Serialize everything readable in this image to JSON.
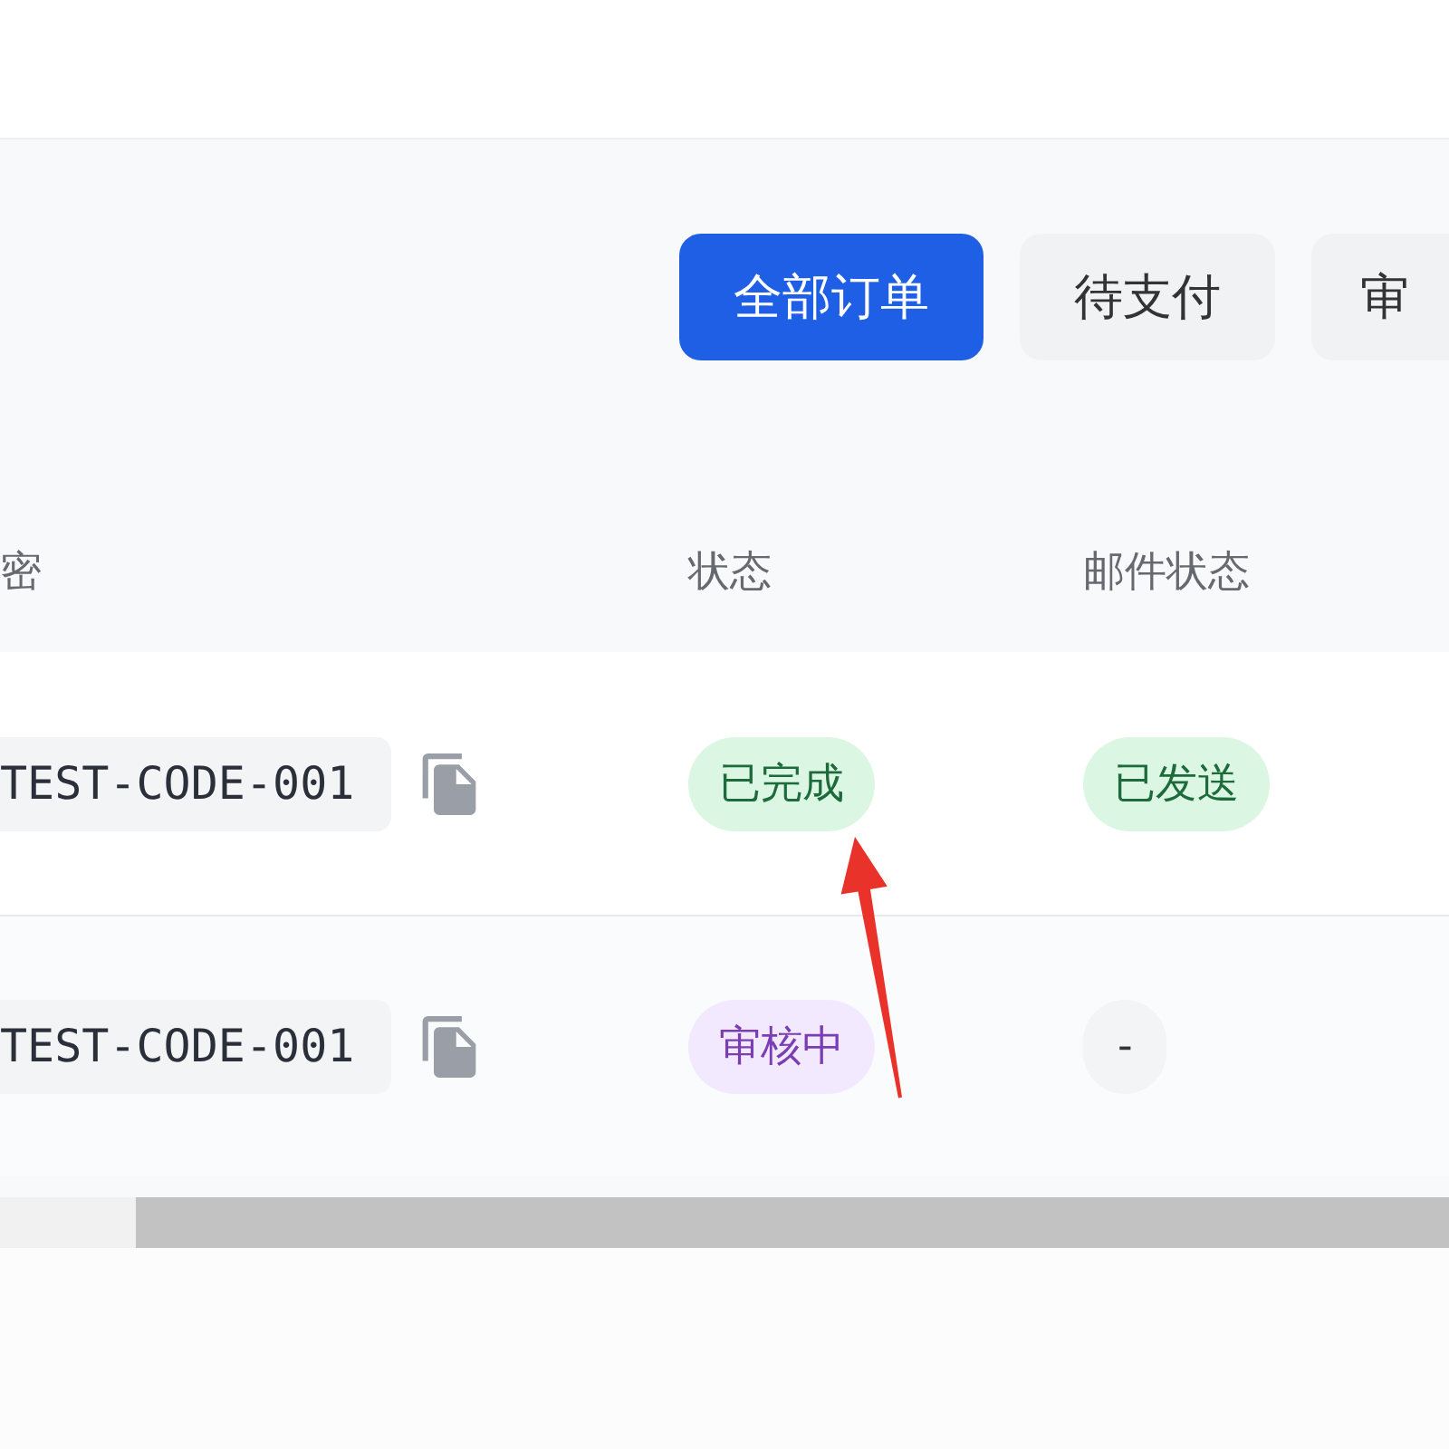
{
  "tabs": [
    {
      "label": "全部订单",
      "selected": true
    },
    {
      "label": "待支付",
      "selected": false
    },
    {
      "label": "审",
      "selected": false
    }
  ],
  "table": {
    "columns": [
      "密",
      "状态",
      "邮件状态"
    ],
    "rows": [
      {
        "code": "TEST-CODE-001",
        "status": {
          "label": "已完成",
          "kind": "success"
        },
        "mail_status": {
          "label": "已发送",
          "kind": "success"
        }
      },
      {
        "code": "TEST-CODE-001",
        "status": {
          "label": "审核中",
          "kind": "review"
        },
        "mail_status": {
          "label": "-",
          "kind": "empty"
        }
      }
    ]
  }
}
